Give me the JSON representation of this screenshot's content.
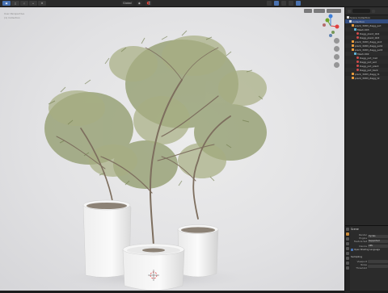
{
  "topbar": {
    "mode_label": "Object",
    "menus": [
      "View",
      "Select",
      "Add",
      "Object"
    ],
    "orientation_label": "Global",
    "options_label": "Options"
  },
  "viewport": {
    "info_line_1": "User Perspective",
    "info_line_2": "(1) Collection"
  },
  "outliner": {
    "rows": [
      {
        "label": "Scene Collection",
        "icon": "collection-icon"
      },
      {
        "label": "Collection",
        "icon": "collection-icon"
      },
      {
        "label": "plant_3083_Zagg_pot",
        "icon": "object-icon"
      },
      {
        "label": "Mesh.003",
        "icon": "mesh-icon"
      },
      {
        "label": "Dagg_plant_004",
        "icon": "material-icon"
      },
      {
        "label": "Dagg_plant_003",
        "icon": "material-icon"
      },
      {
        "label": "plant_3083_Zagg_plnt",
        "icon": "object-icon"
      },
      {
        "label": "plant_3083_Zagg_pot2",
        "icon": "object-icon"
      },
      {
        "label": "plant_3083_Zagg_pot3",
        "icon": "object-icon"
      },
      {
        "label": "Mesh.002",
        "icon": "mesh-icon"
      },
      {
        "label": "Dagg_pot_mat",
        "icon": "material-icon"
      },
      {
        "label": "Dagg_pot_soil",
        "icon": "material-icon"
      },
      {
        "label": "Dagg_pot_plant",
        "icon": "material-icon"
      },
      {
        "label": "Dagg_pot_bark",
        "icon": "material-icon"
      },
      {
        "label": "plant_3083_Zagg_t1",
        "icon": "object-icon"
      },
      {
        "label": "plant_3083_Zagg_t2",
        "icon": "object-icon"
      }
    ]
  },
  "properties": {
    "title": "Scene",
    "render_engine_label": "Render Engine",
    "render_engine_value": "Cycles",
    "feature_set_label": "Feature Set",
    "feature_set_value": "Supported",
    "device_label": "Device",
    "device_value": "CPU",
    "osl_label": "Open Shading Language",
    "sampling_label": "Sampling",
    "viewport_label": "Viewport",
    "noise_label": "Noise Threshold"
  },
  "colors": {
    "accent": "#4772b3",
    "axis_x": "#e0403f",
    "axis_y": "#6ea52a",
    "axis_z": "#3e7fd8"
  }
}
